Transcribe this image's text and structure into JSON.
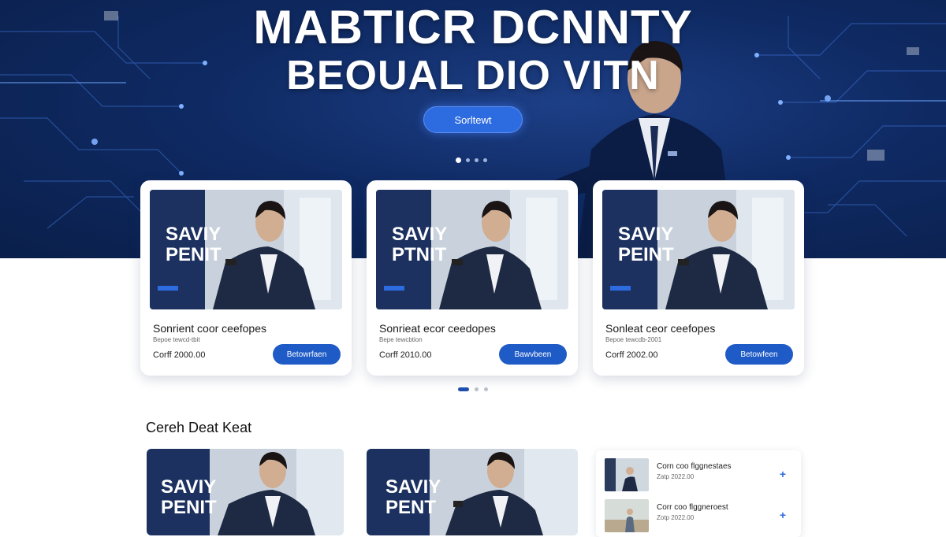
{
  "hero": {
    "title_line1": "MABTICR DCNNTY",
    "title_line2": "BEOUAL DIO VITN",
    "cta_label": "Sorltewt",
    "dots": 4
  },
  "cards": [
    {
      "thumb_text_1": "SAVIY",
      "thumb_text_2": "PENIT",
      "title": "Sonrient coor ceefopes",
      "sub": "Bepoe tewcd-tbit",
      "price": "Corff 2000.00",
      "button": "Betowrfaen"
    },
    {
      "thumb_text_1": "SAVIY",
      "thumb_text_2": "PTNIT",
      "title": "Sonrieat ecor ceedopes",
      "sub": "Bepe tewcbtion",
      "price": "Corff 2010.00",
      "button": "Bawvbeen"
    },
    {
      "thumb_text_1": "SAVIY",
      "thumb_text_2": "PEINT",
      "title": "Sonleat ceor ceefopes",
      "sub": "Bepoe tewcdb-2001",
      "price": "Corff 2002.00",
      "button": "Betowfeen"
    }
  ],
  "section": {
    "title": "Cereh Deat Keat"
  },
  "bottom_thumbs": [
    {
      "text_1": "SAVIY",
      "text_2": "PENIT"
    },
    {
      "text_1": "SAVIY",
      "text_2": "PENT"
    }
  ],
  "side_list": [
    {
      "title": "Corn coo flggnestaes",
      "sub": "Zatp 2022.00"
    },
    {
      "title": "Corr coo flggneroest",
      "sub": "Zotp 2022.00"
    }
  ],
  "colors": {
    "hero_bg": "#0f2a63",
    "accent": "#1f5bc7",
    "cta": "#2d6be0"
  }
}
